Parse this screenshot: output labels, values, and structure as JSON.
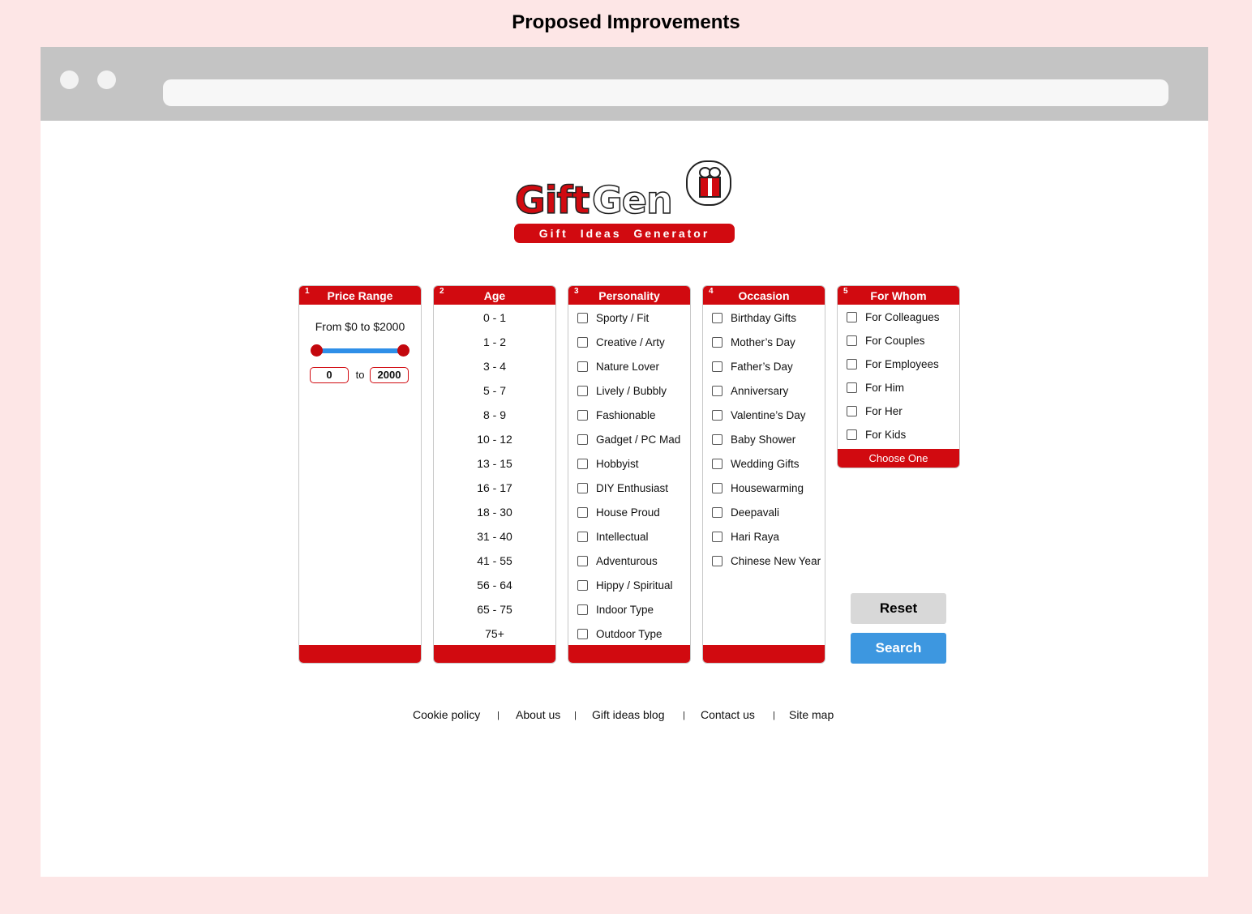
{
  "page_heading": "Proposed Improvements",
  "logo": {
    "word1": "Gift",
    "word2": "Gen",
    "tagline": "Gift Ideas Generator",
    "icon": "gift-box-icon"
  },
  "colors": {
    "brand_red": "#d10a10",
    "search_blue": "#3d97e0",
    "reset_gray": "#d8d8d8",
    "background_pink": "#fde6e6",
    "browser_chrome": "#c4c4c4"
  },
  "panels": {
    "price": {
      "number": "1",
      "title": "Price Range",
      "range_label": "From $0 to $2000",
      "min_value": "0",
      "max_value": "2000",
      "to_label": "to",
      "slider_min_fraction": 0,
      "slider_max_fraction": 1
    },
    "age": {
      "number": "2",
      "title": "Age",
      "options": [
        "0 - 1",
        "1 - 2",
        "3 - 4",
        "5 - 7",
        "8 - 9",
        "10 - 12",
        "13 - 15",
        "16 - 17",
        "18 - 30",
        "31 - 40",
        "41 - 55",
        "56 - 64",
        "65 - 75",
        "75+"
      ]
    },
    "personality": {
      "number": "3",
      "title": "Personality",
      "options": [
        "Sporty / Fit",
        "Creative / Arty",
        "Nature Lover",
        "Lively / Bubbly",
        "Fashionable",
        "Gadget / PC Mad",
        "Hobbyist",
        "DIY Enthusiast",
        "House Proud",
        "Intellectual",
        "Adventurous",
        "Hippy / Spiritual",
        "Indoor Type",
        "Outdoor Type"
      ]
    },
    "occasion": {
      "number": "4",
      "title": "Occasion",
      "options": [
        "Birthday Gifts",
        "Mother’s Day",
        "Father’s Day",
        "Anniversary",
        "Valentine’s Day",
        "Baby Shower",
        "Wedding Gifts",
        "Housewarming",
        "Deepavali",
        "Hari Raya",
        "Chinese New Year"
      ]
    },
    "for_whom": {
      "number": "5",
      "title": "For Whom",
      "options": [
        "For Colleagues",
        "For Couples",
        "For Employees",
        "For Him",
        "For Her",
        "For Kids"
      ],
      "footer": "Choose One"
    }
  },
  "buttons": {
    "reset": "Reset",
    "search": "Search"
  },
  "footer": {
    "links": [
      "Cookie policy",
      "About us",
      "Gift ideas blog",
      "Contact us",
      "Site map"
    ],
    "separator": "|"
  }
}
